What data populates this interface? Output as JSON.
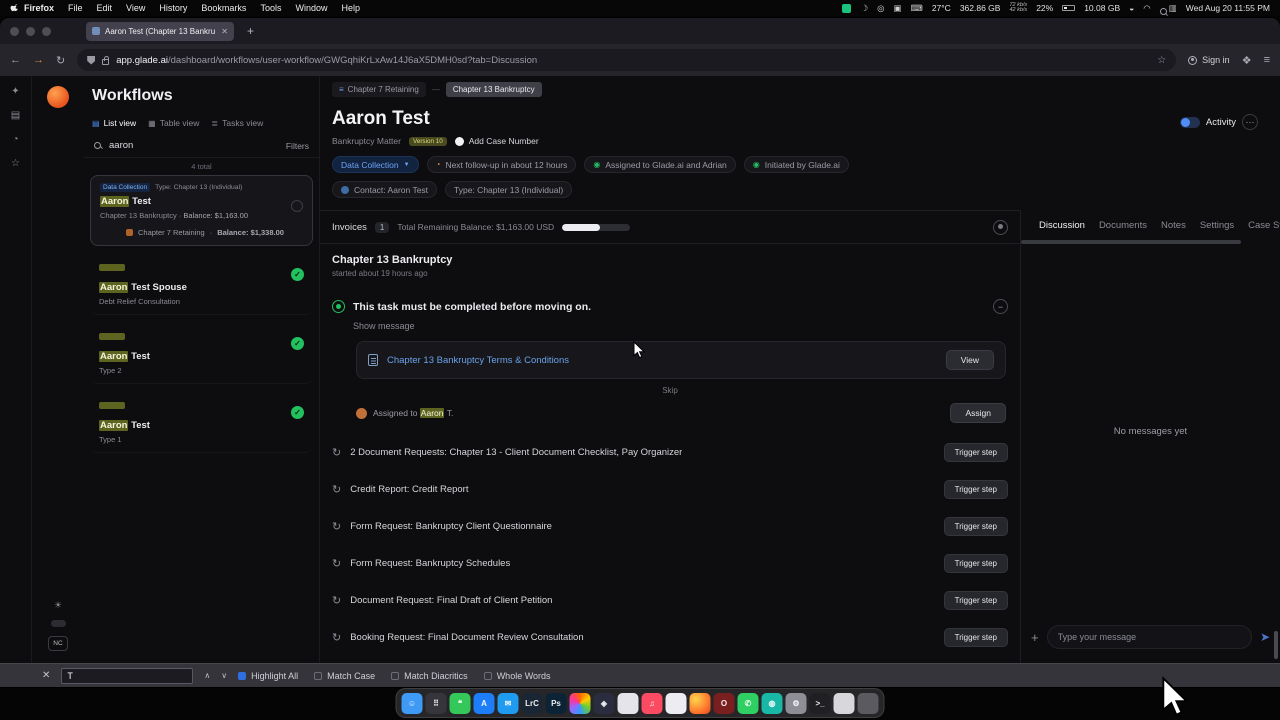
{
  "colors": {
    "accent": "#4f8ef7",
    "link": "#6aa3e8",
    "green": "#23c060",
    "hl": "#5d6420",
    "orange": "#e8962e"
  },
  "menubar": {
    "menus": [
      "Firefox",
      "File",
      "Edit",
      "View",
      "History",
      "Bookmarks",
      "Tools",
      "Window",
      "Help"
    ],
    "status": {
      "temp": "27°C",
      "storage": "362.86 GB",
      "net_up": "72 kb/s",
      "net_down": "42 kb/s",
      "battery": "22%",
      "memory": "10.08 GB",
      "clock": "Wed Aug 20 11:55 PM"
    }
  },
  "browser": {
    "tab": {
      "title": "Aaron Test (Chapter 13 Bankru"
    },
    "url_domain": "app.glade.ai",
    "url_path": "/dashboard/workflows/user-workflow/GWGqhiKrLxAw14J6aX5DMH0sd?tab=Discussion",
    "sign_in": "Sign in"
  },
  "app": {
    "sidebar": {
      "title": "Workflows",
      "views": [
        "List view",
        "Table view",
        "Tasks view"
      ],
      "search": "aaron",
      "filters": "Filters",
      "total": "4 total",
      "items": [
        {
          "status": "Data Collection",
          "type": "Type: Chapter 13 (Individual)",
          "name_hl": "Aaron",
          "name_rest": " Test",
          "line1_label": "Chapter 13 Bankruptcy",
          "line1_balance": "Balance: $1,163.00",
          "line2_label": "Chapter 7 Retaining",
          "line2_balance": "Balance: $1,338.00"
        },
        {
          "name_hl": "Aaron",
          "name_rest": " Test Spouse",
          "sub": "Debt Relief Consultation"
        },
        {
          "name_hl": "Aaron",
          "name_rest": " Test",
          "sub": "Type 2"
        },
        {
          "name_hl": "Aaron",
          "name_rest": " Test",
          "sub": "Type 1"
        }
      ],
      "profile_initials": "NC"
    },
    "header": {
      "breadcrumb": [
        "Chapter 7 Retaining",
        "Chapter 13 Bankruptcy"
      ],
      "title": "Aaron Test",
      "matter": "Bankruptcy Matter",
      "version": "Version 10",
      "add_case": "Add Case Number",
      "status_chip": "Data Collection",
      "followup_chip": "Next follow-up in about 12 hours",
      "assigned_chip": "Assigned to Glade.ai and Adrian",
      "initiated_chip": "Initiated by Glade.ai",
      "contact_chip": "Contact: Aaron Test",
      "type_chip": "Type: Chapter 13 (Individual)",
      "activity": "Activity"
    },
    "main": {
      "invoices_label": "Invoices",
      "invoices_count": "1",
      "invoices_balance": "Total Remaining Balance: $1,163.00 USD",
      "section_title": "Chapter 13 Bankruptcy",
      "section_started": "started about 19 hours ago",
      "task_notice": "This task must be completed before moving on.",
      "show_message": "Show message",
      "terms_title": "Chapter 13 Bankruptcy Terms & Conditions",
      "view_button": "View",
      "skip": "Skip",
      "assigned_prefix": "Assigned to",
      "assigned_hl": "Aaron",
      "assigned_suffix": "T.",
      "assign_button": "Assign",
      "trigger_button": "Trigger step",
      "steps": [
        "2 Document Requests: Chapter 13 - Client Document Checklist, Pay Organizer",
        "Credit Report: Credit Report",
        "Form Request: Bankruptcy Client Questionnaire",
        "Form Request: Bankruptcy Schedules",
        "Document Request: Final Draft of Client Petition",
        "Booking Request: Final Document Review Consultation"
      ]
    },
    "panel": {
      "tabs": [
        "Discussion",
        "Documents",
        "Notes",
        "Settings",
        "Case Stat"
      ],
      "empty": "No messages yet",
      "placeholder": "Type your message"
    }
  },
  "findbar": {
    "value": "T",
    "options": [
      "Highlight All",
      "Match Case",
      "Match Diacritics",
      "Whole Words"
    ]
  },
  "dock": {
    "apps": [
      {
        "name": "finder",
        "color": "#3f9af5",
        "glyph": "☺"
      },
      {
        "name": "launchpad",
        "color": "#35353b",
        "glyph": "⠿"
      },
      {
        "name": "messages",
        "color": "#34c85a",
        "glyph": "❝"
      },
      {
        "name": "app-store",
        "color": "#1e7ef7",
        "glyph": "A"
      },
      {
        "name": "mail",
        "color": "#1f9bf0",
        "glyph": "✉"
      },
      {
        "name": "lightroom",
        "color": "#1a2633",
        "glyph": "LrC"
      },
      {
        "name": "photoshop",
        "color": "#0c2336",
        "glyph": "Ps"
      },
      {
        "name": "photos",
        "color": "conic-gradient(#f60,#fc0,#6c3,#39f,#96f,#f39,#f60)",
        "glyph": ""
      },
      {
        "name": "code-editor",
        "color": "#2a2d3e",
        "glyph": "◈"
      },
      {
        "name": "preview",
        "color": "#e4e4ea",
        "glyph": ""
      },
      {
        "name": "music",
        "color": "#fa4b63",
        "glyph": "♫"
      },
      {
        "name": "calendar",
        "color": "#ececf2",
        "glyph": ""
      },
      {
        "name": "firefox",
        "color": "radial-gradient(circle at 30% 30%,#ffd54d,#ff7a2e 60%,#e8431f)",
        "glyph": ""
      },
      {
        "name": "opera",
        "color": "#7a1f1f",
        "glyph": "O"
      },
      {
        "name": "whatsapp",
        "color": "#2fcf64",
        "glyph": "✆"
      },
      {
        "name": "teal-app",
        "color": "#19b8a6",
        "glyph": "◍"
      },
      {
        "name": "settings",
        "color": "#8e8e96",
        "glyph": "⚙"
      },
      {
        "name": "terminal",
        "color": "#202024",
        "glyph": ">_"
      },
      {
        "name": "notes",
        "color": "#d8d8dc",
        "glyph": ""
      },
      {
        "name": "trash",
        "color": "#5a5a60",
        "glyph": ""
      }
    ]
  }
}
